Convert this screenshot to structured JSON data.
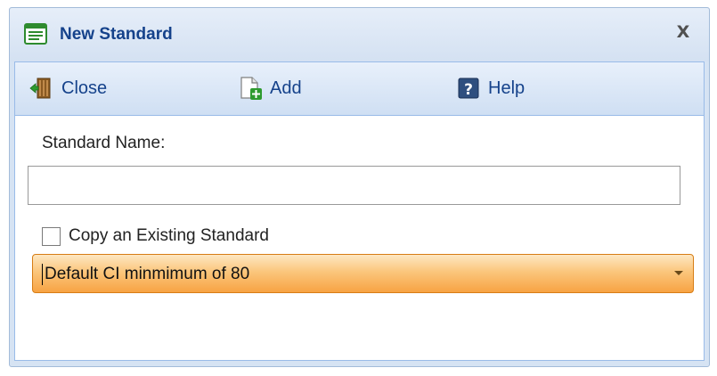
{
  "window": {
    "title": "New Standard",
    "title_icon": "form-window-icon",
    "close_label": "X"
  },
  "toolbar": {
    "close": {
      "label": "Close",
      "icon": "door-exit-icon"
    },
    "add": {
      "label": "Add",
      "icon": "new-document-add-icon"
    },
    "help": {
      "label": "Help",
      "icon": "help-question-icon"
    }
  },
  "form": {
    "standard_name_label": "Standard Name:",
    "standard_name_value": "",
    "copy_checkbox_label": "Copy an Existing Standard",
    "copy_checked": false,
    "existing_standard_selected": "Default CI minmimum of 80"
  },
  "colors": {
    "title_text": "#15428b",
    "toolbar_text": "#15428b",
    "dropdown_fill": "#f7a343",
    "dropdown_border": "#d77d15"
  }
}
